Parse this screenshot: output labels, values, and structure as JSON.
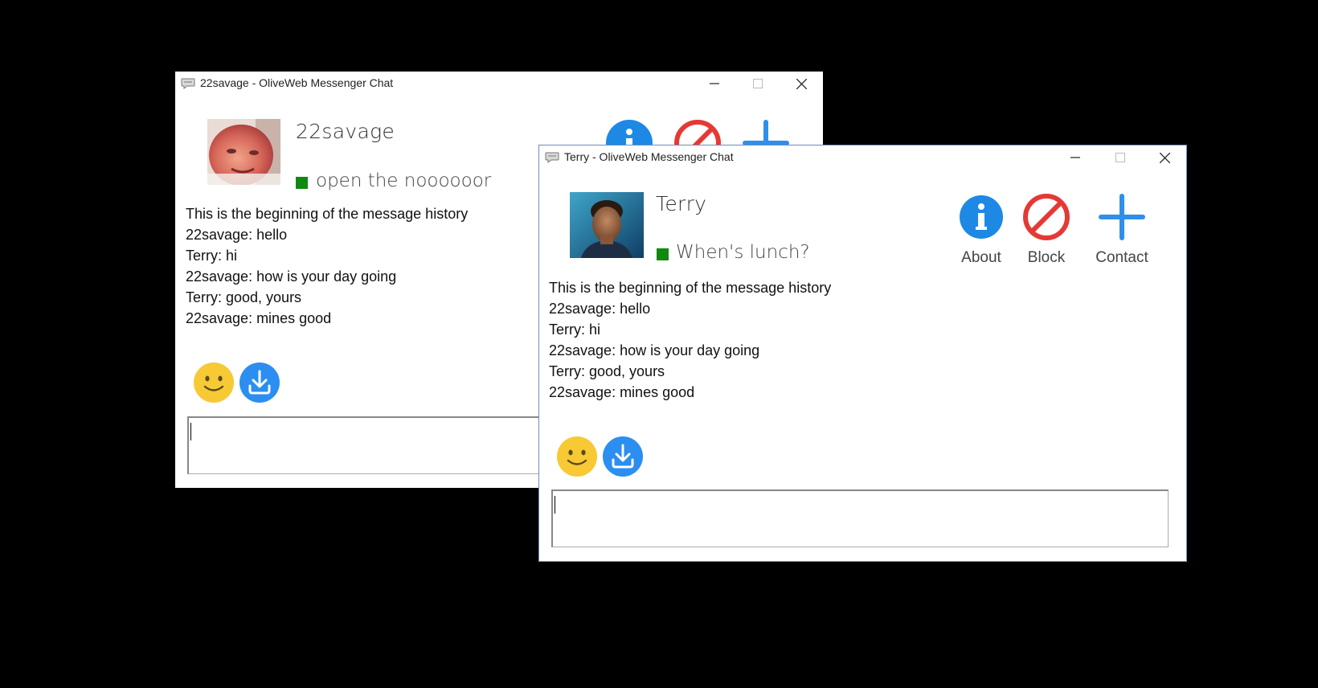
{
  "windows": [
    {
      "title": "22savage - OliveWeb Messenger Chat",
      "contact": {
        "name": "22savage",
        "status_text": "open the noooooor",
        "status_color": "#0f8a0f"
      },
      "history": [
        "This is the beginning of the message history",
        "22savage: hello",
        "Terry: hi",
        "22savage: how is your day going",
        "Terry: good, yours",
        "22savage: mines good"
      ]
    },
    {
      "title": "Terry - OliveWeb Messenger Chat",
      "contact": {
        "name": "Terry",
        "status_text": "When's lunch?",
        "status_color": "#0f8a0f"
      },
      "actions": {
        "about": "About",
        "block": "Block",
        "contact": "Contact"
      },
      "history": [
        "This is the beginning of the message history",
        "22savage: hello",
        "Terry: hi",
        "22savage: how is your day going",
        "Terry: good, yours",
        "22savage: mines good"
      ]
    }
  ],
  "icons": {
    "app": "chat-bubble-icon",
    "minimize": "minimize-icon",
    "maximize": "maximize-icon",
    "close": "close-icon",
    "about": "info-icon",
    "block": "block-icon",
    "contact": "plus-icon",
    "emoji": "smiley-icon",
    "download": "download-icon"
  },
  "colors": {
    "info_blue": "#1e88e5",
    "block_red": "#e53935",
    "plus_blue": "#2f8fea",
    "smiley_yellow": "#f7c935",
    "download_blue": "#2b8ef0",
    "status_green": "#0f8a0f"
  }
}
